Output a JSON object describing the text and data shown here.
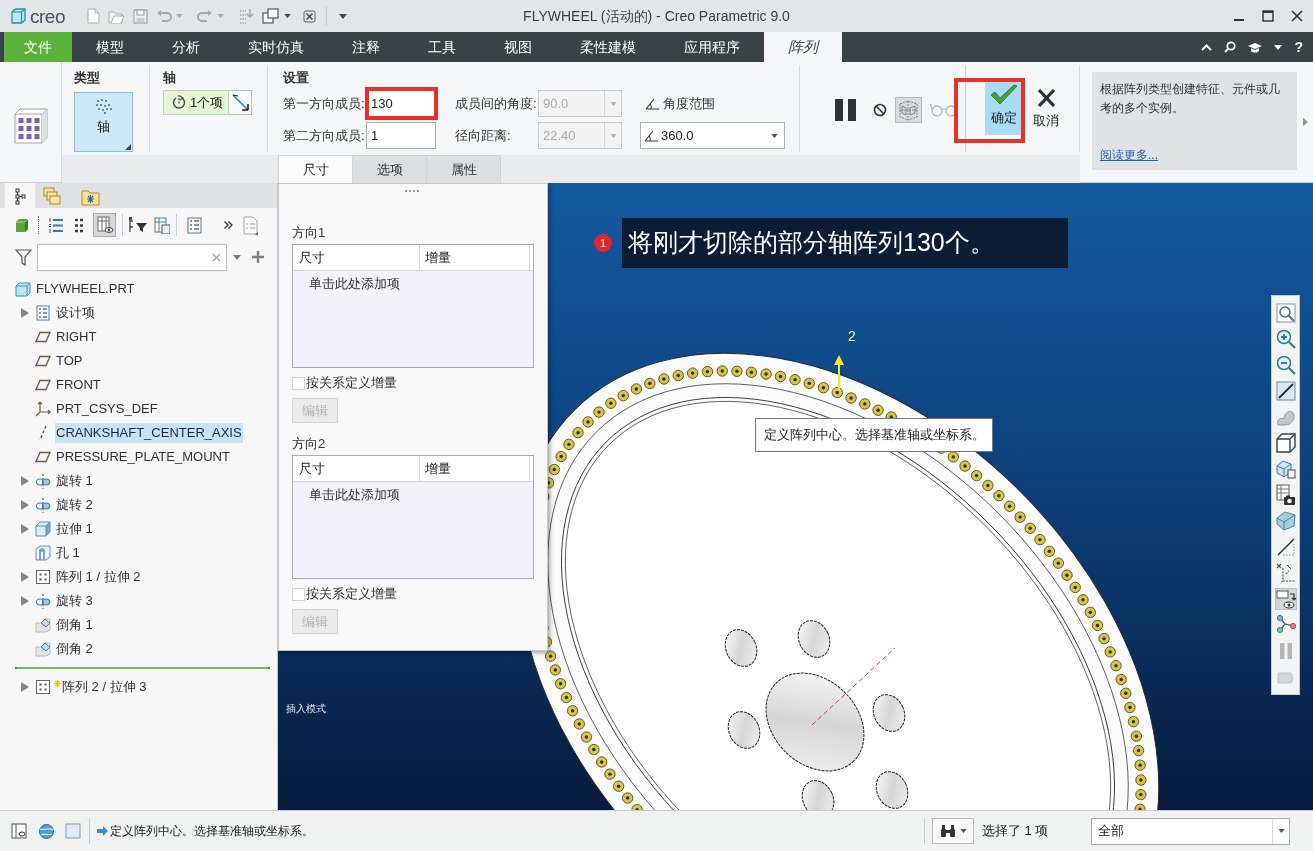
{
  "title_bar": {
    "logo_text": "creo",
    "title": "FLYWHEEL (活动的) - Creo Parametric 9.0"
  },
  "menu": {
    "file": "文件",
    "tabs": [
      {
        "label": "模型",
        "selected": false
      },
      {
        "label": "分析",
        "selected": false
      },
      {
        "label": "实时仿真",
        "selected": false
      },
      {
        "label": "注释",
        "selected": false
      },
      {
        "label": "工具",
        "selected": false
      },
      {
        "label": "视图",
        "selected": false
      },
      {
        "label": "柔性建模",
        "selected": false
      },
      {
        "label": "应用程序",
        "selected": false
      },
      {
        "label": "阵列",
        "selected": true
      }
    ],
    "help": "?"
  },
  "ribbon": {
    "type_group": {
      "title": "类型",
      "button": "轴"
    },
    "axis_group": {
      "title": "轴",
      "collector": "1个项"
    },
    "settings": {
      "title": "设置",
      "fields": [
        {
          "label": "第一方向成员:",
          "value": "130",
          "disabled": false,
          "dropdown": false,
          "highlighted": true
        },
        {
          "label": "成员间的角度:",
          "value": "90.0",
          "disabled": true,
          "dropdown": true,
          "highlighted": false
        },
        {
          "label": "第二方向成员:",
          "value": "1",
          "disabled": false,
          "dropdown": false,
          "highlighted": false
        },
        {
          "label": "径向距离:",
          "value": "22.40",
          "disabled": true,
          "dropdown": true,
          "highlighted": false
        }
      ],
      "angle_range": {
        "label": "角度范围",
        "value": "360.0"
      }
    },
    "operations": [
      {
        "kind": "pause",
        "selected": false,
        "disabled": false
      },
      {
        "kind": "stop",
        "selected": false,
        "disabled": false
      },
      {
        "kind": "preview",
        "selected": true,
        "disabled": false
      },
      {
        "kind": "glasses",
        "selected": false,
        "disabled": true
      }
    ],
    "confirm": {
      "label": "确定",
      "highlighted": true
    },
    "cancel": {
      "label": "取消"
    },
    "help": {
      "lines": [
        "根据阵列类型创建特征、元件或几",
        "考的多个实例。"
      ],
      "link": "阅读更多..."
    },
    "panel_tabs": [
      {
        "label": "尺寸",
        "selected": true
      },
      {
        "label": "选项",
        "selected": false
      },
      {
        "label": "属性",
        "selected": false
      }
    ]
  },
  "model_tree": {
    "tabs": [
      {
        "kind": "tree",
        "selected": true
      },
      {
        "kind": "layers",
        "selected": false
      },
      {
        "kind": "folder",
        "selected": false
      }
    ],
    "toolbar": [
      {
        "kind": "cube",
        "selected": false
      },
      {
        "kind": "list",
        "selected": false
      },
      {
        "kind": "dots",
        "selected": false
      },
      {
        "kind": "columns",
        "selected": true
      },
      {
        "kind": "tree_filter",
        "selected": false
      },
      {
        "kind": "table",
        "selected": false
      },
      {
        "kind": "details",
        "selected": false
      },
      {
        "kind": "more",
        "selected": false
      },
      {
        "kind": "document",
        "selected": false
      }
    ],
    "root": "FLYWHEEL.PRT",
    "items": [
      {
        "label": "设计项",
        "kind": "design_items",
        "expandable": true,
        "selected": false,
        "new": false
      },
      {
        "label": "RIGHT",
        "kind": "plane",
        "expandable": false,
        "selected": false,
        "new": false
      },
      {
        "label": "TOP",
        "kind": "plane",
        "expandable": false,
        "selected": false,
        "new": false
      },
      {
        "label": "FRONT",
        "kind": "plane",
        "expandable": false,
        "selected": false,
        "new": false
      },
      {
        "label": "PRT_CSYS_DEF",
        "kind": "csys",
        "expandable": false,
        "selected": false,
        "new": false
      },
      {
        "label": "CRANKSHAFT_CENTER_AXIS",
        "kind": "axis",
        "expandable": false,
        "selected": true,
        "new": false
      },
      {
        "label": "PRESSURE_PLATE_MOUNT",
        "kind": "plane",
        "expandable": false,
        "selected": false,
        "new": false
      },
      {
        "label": "旋转 1",
        "kind": "revolve",
        "expandable": true,
        "selected": false,
        "new": false
      },
      {
        "label": "旋转 2",
        "kind": "revolve",
        "expandable": true,
        "selected": false,
        "new": false
      },
      {
        "label": "拉伸 1",
        "kind": "extrude",
        "expandable": true,
        "selected": false,
        "new": false
      },
      {
        "label": "孔 1",
        "kind": "hole",
        "expandable": false,
        "selected": false,
        "new": false
      },
      {
        "label": "阵列 1 / 拉伸 2",
        "kind": "pattern",
        "expandable": true,
        "selected": false,
        "new": false
      },
      {
        "label": "旋转 3",
        "kind": "revolve",
        "expandable": true,
        "selected": false,
        "new": false
      },
      {
        "label": "倒角 1",
        "kind": "chamfer",
        "expandable": false,
        "selected": false,
        "new": false
      },
      {
        "label": "倒角 2",
        "kind": "chamfer",
        "expandable": false,
        "selected": false,
        "new": false
      }
    ],
    "items_after_insert": [
      {
        "label": "阵列 2 / 拉伸 3",
        "kind": "pattern",
        "expandable": true,
        "selected": false,
        "new": true
      }
    ]
  },
  "dimensions_panel": {
    "directions": [
      {
        "title": "方向1",
        "columns": [
          "尺寸",
          "增量"
        ],
        "add_row": "单击此处添加项",
        "relation_checkbox": {
          "label": "按关系定义增量",
          "checked": false
        },
        "edit_button": {
          "label": "编辑",
          "disabled": true
        }
      },
      {
        "title": "方向2",
        "columns": [
          "尺寸",
          "增量"
        ],
        "add_row": "单击此处添加项",
        "relation_checkbox": {
          "label": "按关系定义增量",
          "checked": false
        },
        "edit_button": {
          "label": "编辑",
          "disabled": true
        }
      }
    ]
  },
  "viewport": {
    "callout": {
      "step": "1",
      "text": "将刚才切除的部分轴阵列130个。"
    },
    "direction_label": "2",
    "tooltip": "定义阵列中心。选择基准轴或坐标系。",
    "mode_label": "插入模式",
    "view_toolbar": [
      {
        "kind": "refit",
        "selected": false,
        "disabled": false
      },
      {
        "kind": "zoom_in",
        "selected": false,
        "disabled": false
      },
      {
        "kind": "zoom_out",
        "selected": false,
        "disabled": false
      },
      {
        "kind": "repaint",
        "selected": false,
        "disabled": false
      },
      {
        "kind": "shading",
        "selected": false,
        "disabled": false
      },
      {
        "kind": "saved_views",
        "selected": false,
        "disabled": false
      },
      {
        "kind": "view_manager",
        "selected": false,
        "disabled": false
      },
      {
        "kind": "snapshot",
        "selected": false,
        "disabled": false
      },
      {
        "kind": "display_style",
        "selected": false,
        "disabled": false
      },
      {
        "kind": "plane_display",
        "selected": false,
        "disabled": false
      },
      {
        "kind": "csys_display",
        "selected": false,
        "disabled": false
      },
      {
        "kind": "annotation_display",
        "selected": true,
        "disabled": false
      },
      {
        "kind": "spin_center",
        "selected": false,
        "disabled": false
      },
      {
        "kind": "pause",
        "selected": false,
        "disabled": true
      },
      {
        "kind": "section",
        "selected": false,
        "disabled": true
      }
    ]
  },
  "status_bar": {
    "message": "定义阵列中心。选择基准轴或坐标系。",
    "selection": "选择了 1 项",
    "filter": "全部"
  }
}
